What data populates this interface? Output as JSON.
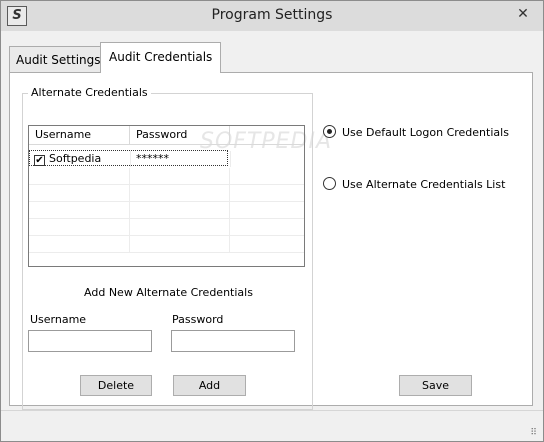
{
  "window": {
    "title": "Program Settings",
    "app_icon": "S",
    "close_glyph": "✕"
  },
  "tabs": [
    {
      "label": "Audit Settings",
      "active": false
    },
    {
      "label": "Audit Credentials",
      "active": true
    }
  ],
  "watermark": "SOFTPEDIA",
  "alternate_credentials": {
    "group_label": "Alternate Credentials",
    "columns": [
      "Username",
      "Password"
    ],
    "rows": [
      {
        "checked": true,
        "username": "Softpedia",
        "password": "******"
      }
    ],
    "add_new_label": "Add New Alternate Credentials",
    "username_label": "Username",
    "password_label": "Password",
    "username_value": "",
    "password_value": "",
    "delete_label": "Delete",
    "add_label": "Add"
  },
  "options": {
    "default_logon_label": "Use Default Logon Credentials",
    "alternate_list_label": "Use Alternate Credentials List",
    "selected": "default",
    "save_label": "Save"
  },
  "icons": {
    "checkbox_check": "✔",
    "size_grip": "⠿"
  }
}
